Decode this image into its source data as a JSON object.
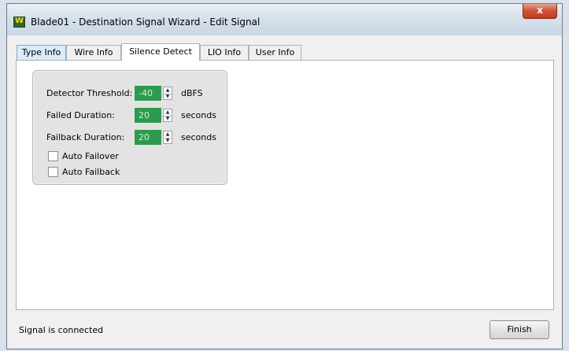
{
  "window": {
    "title": "Blade01 - Destination Signal Wizard - Edit Signal",
    "app_icon_letter": "W",
    "close_glyph": "x"
  },
  "tabs": [
    {
      "label": "Type Info",
      "state": "hover"
    },
    {
      "label": "Wire Info",
      "state": "normal"
    },
    {
      "label": "Silence Detect",
      "state": "active"
    },
    {
      "label": "LIO Info",
      "state": "normal"
    },
    {
      "label": "User Info",
      "state": "normal"
    }
  ],
  "silence_detect": {
    "threshold": {
      "label": "Detector Threshold:",
      "value": "-40",
      "unit": "dBFS"
    },
    "failed_duration": {
      "label": "Failed Duration:",
      "value": "20",
      "unit": "seconds"
    },
    "failback_duration": {
      "label": "Failback Duration:",
      "value": "20",
      "unit": "seconds"
    },
    "auto_failover": {
      "label": "Auto Failover",
      "checked": false
    },
    "auto_failback": {
      "label": "Auto Failback",
      "checked": false
    }
  },
  "footer": {
    "status": "Signal is connected",
    "finish_label": "Finish"
  },
  "colors": {
    "numeric_field_bg": "#2e9a4e",
    "numeric_field_text": "#d6eedd",
    "close_button": "#c23a1d"
  }
}
